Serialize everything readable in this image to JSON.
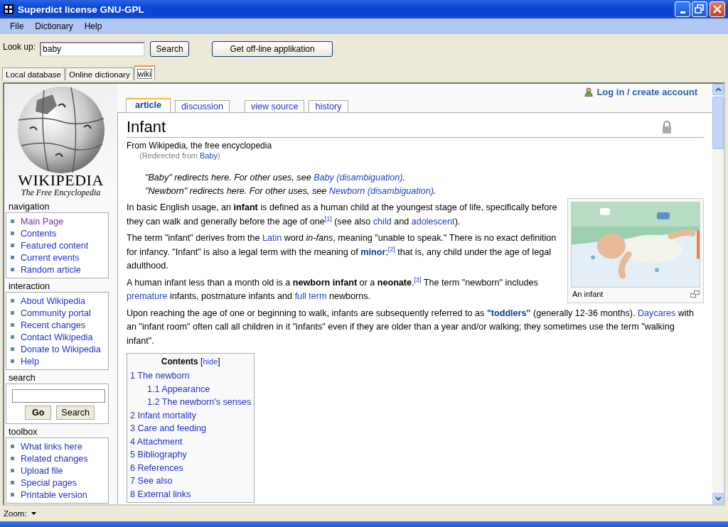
{
  "window": {
    "title": "Superdict license GNU-GPL"
  },
  "menu": [
    "File",
    "Dictionary",
    "Help"
  ],
  "lookup": {
    "label": "Look up:",
    "value": "baby",
    "search_button": "Search",
    "offline_button": "Get off-line applikation"
  },
  "tabs": [
    {
      "label": "Local database",
      "selected": false
    },
    {
      "label": "Online dictionary",
      "selected": false
    },
    {
      "label": "wiki",
      "selected": true
    }
  ],
  "wiki": {
    "logo": {
      "title": "WIKIPEDIA",
      "tagline": "The Free Encyclopedia"
    },
    "portlets": [
      {
        "kind": "links",
        "heading": "navigation",
        "items": [
          {
            "label": "Main Page",
            "visited": true
          },
          {
            "label": "Contents",
            "visited": false
          },
          {
            "label": "Featured content",
            "visited": false
          },
          {
            "label": "Current events",
            "visited": false
          },
          {
            "label": "Random article",
            "visited": false
          }
        ]
      },
      {
        "kind": "links",
        "heading": "interaction",
        "items": [
          {
            "label": "About Wikipedia",
            "visited": false
          },
          {
            "label": "Community portal",
            "visited": false
          },
          {
            "label": "Recent changes",
            "visited": false
          },
          {
            "label": "Contact Wikipedia",
            "visited": false
          },
          {
            "label": "Donate to Wikipedia",
            "visited": false
          },
          {
            "label": "Help",
            "visited": false
          }
        ]
      },
      {
        "kind": "search",
        "heading": "search",
        "buttons": [
          "Go",
          "Search"
        ]
      },
      {
        "kind": "links",
        "heading": "toolbox",
        "items": [
          {
            "label": "What links here",
            "visited": false
          },
          {
            "label": "Related changes",
            "visited": false
          },
          {
            "label": "Upload file",
            "visited": false
          },
          {
            "label": "Special pages",
            "visited": false
          },
          {
            "label": "Printable version",
            "visited": false
          }
        ]
      }
    ],
    "personal": {
      "label": "Log in / create account"
    },
    "page_tab_groups": [
      [
        {
          "label": "article",
          "selected": true
        },
        {
          "label": "discussion",
          "selected": false
        }
      ],
      [
        {
          "label": "view source",
          "selected": false
        },
        {
          "label": "history",
          "selected": false
        }
      ]
    ],
    "article": {
      "title": "Infant",
      "tagline": "From Wikipedia, the free encyclopedia",
      "redirect": [
        {
          "t": "(Redirected from "
        },
        {
          "t": "Baby",
          "kind": "link"
        },
        {
          "t": ")"
        }
      ],
      "hatnotes": [
        [
          {
            "t": "\"Baby\" redirects here. For other uses, see "
          },
          {
            "t": "Baby (disambiguation)",
            "kind": "link"
          },
          {
            "t": "."
          }
        ],
        [
          {
            "t": "\"Newborn\" redirects here. For other uses, see "
          },
          {
            "t": "Newborn (disambiguation)",
            "kind": "link"
          },
          {
            "t": "."
          }
        ]
      ],
      "figure": {
        "kind": "picture",
        "caption": "An infant"
      },
      "paragraphs": [
        [
          {
            "t": "In basic English usage, an **infant** is defined as a human child at the youngest stage of life, specifically before they can walk and generally before the age of one"
          },
          {
            "t": "[1]",
            "kind": "ref"
          },
          {
            "t": " (see also "
          },
          {
            "t": "child",
            "kind": "link"
          },
          {
            "t": " and "
          },
          {
            "t": "adolescent",
            "kind": "link"
          },
          {
            "t": ")."
          }
        ],
        [
          {
            "t": "The term \"infant\" derives from the "
          },
          {
            "t": "Latin",
            "kind": "link"
          },
          {
            "t": " word *in-fans*, meaning \"unable to speak.\" There is no exact definition for infancy. \"Infant\" is also a legal term with the meaning of "
          },
          {
            "t": "minor",
            "kind": "strong-link"
          },
          {
            "t": ";"
          },
          {
            "t": "[2]",
            "kind": "ref"
          },
          {
            "t": " that is, any child under the age of legal adulthood."
          }
        ],
        [
          {
            "t": "A human infant less than a month old is a **newborn infant** or a **neonate**."
          },
          {
            "t": "[3]",
            "kind": "ref"
          },
          {
            "t": " The term \"newborn\" includes "
          },
          {
            "t": "premature",
            "kind": "link"
          },
          {
            "t": " infants, postmature infants and "
          },
          {
            "t": "full term",
            "kind": "link"
          },
          {
            "t": " newborns."
          }
        ],
        [
          {
            "t": "Upon reaching the age of one or beginning to walk, infants are subsequently referred to as "
          },
          {
            "t": "\"toddlers\"",
            "kind": "strong-link"
          },
          {
            "t": " (generally 12-36 months). "
          },
          {
            "t": "Daycares",
            "kind": "link"
          },
          {
            "t": " with an \"infant room\" often call all children in it \"infants\" even if they are older than a year and/or walking; they sometimes use the term \"walking infant\"."
          }
        ]
      ],
      "toc": {
        "heading": [
          {
            "t": "**Contents** ["
          },
          {
            "t": "hide",
            "kind": "link"
          },
          {
            "t": "]"
          }
        ],
        "items": [
          {
            "label": "1 The newborn",
            "children": [
              {
                "label": "1.1 Appearance"
              },
              {
                "label": "1.2 The newborn's senses"
              }
            ]
          },
          {
            "label": "2 Infant mortality"
          },
          {
            "label": "3 Care and feeding"
          },
          {
            "label": "4 Attachment"
          },
          {
            "label": "5 Bibliography"
          },
          {
            "label": "6 References"
          },
          {
            "label": "7 See also"
          },
          {
            "label": "8 External links"
          }
        ]
      }
    }
  },
  "status_bar": {
    "label": "Zoom:"
  }
}
